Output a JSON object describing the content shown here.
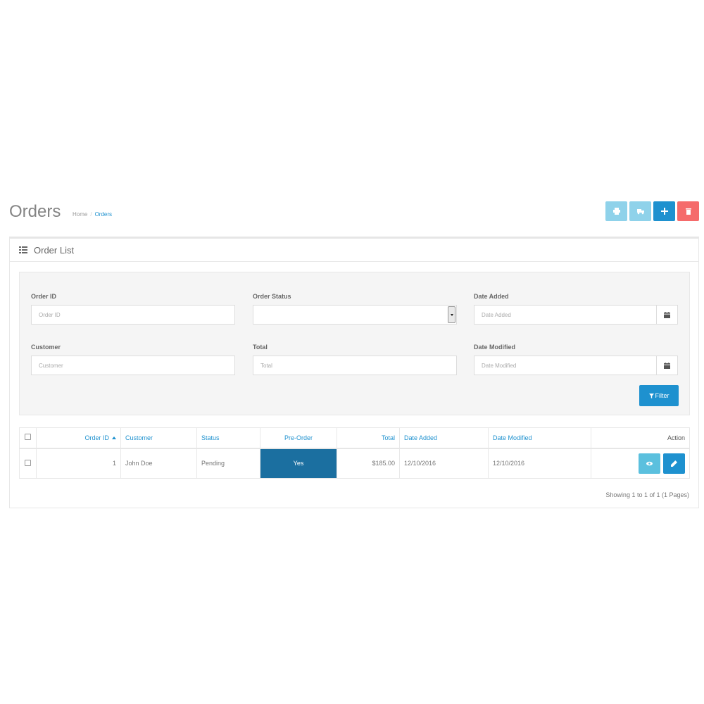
{
  "header": {
    "title": "Orders",
    "breadcrumb": [
      {
        "label": "Home"
      },
      {
        "label": "Orders"
      }
    ]
  },
  "toolbar": {
    "buttons": [
      {
        "icon": "print-icon",
        "color": "#8fd2ea"
      },
      {
        "icon": "truck-icon",
        "color": "#8fd2ea"
      },
      {
        "icon": "plus-icon",
        "color": "#1e91cf"
      },
      {
        "icon": "trash-icon",
        "color": "#f56b6b"
      }
    ]
  },
  "panel": {
    "title": "Order List",
    "icon": "list-icon"
  },
  "filters": {
    "order_id": {
      "label": "Order ID",
      "value": "",
      "placeholder": "Order ID"
    },
    "order_status": {
      "label": "Order Status",
      "value": ""
    },
    "date_added": {
      "label": "Date Added",
      "value": "",
      "placeholder": "Date Added"
    },
    "customer": {
      "label": "Customer",
      "value": "",
      "placeholder": "Customer"
    },
    "total": {
      "label": "Total",
      "value": "",
      "placeholder": "Total"
    },
    "date_modified": {
      "label": "Date Modified",
      "value": "",
      "placeholder": "Date Modified"
    },
    "filter_button": "Filter"
  },
  "table": {
    "columns": [
      "Order ID",
      "Customer",
      "Status",
      "Pre-Order",
      "Total",
      "Date Added",
      "Date Modified",
      "Action"
    ],
    "rows": [
      {
        "order_id": "1",
        "customer": "John Doe",
        "status": "Pending",
        "pre_order": "Yes",
        "total": "$185.00",
        "date_added": "12/10/2016",
        "date_modified": "12/10/2016"
      }
    ]
  },
  "pagination": {
    "info": "Showing 1 to 1 of 1 (1 Pages)"
  },
  "colors": {
    "primary": "#1e91cf",
    "info": "#5bc0de",
    "danger": "#f56b6b",
    "preorder_bg": "#1b6fa0"
  }
}
